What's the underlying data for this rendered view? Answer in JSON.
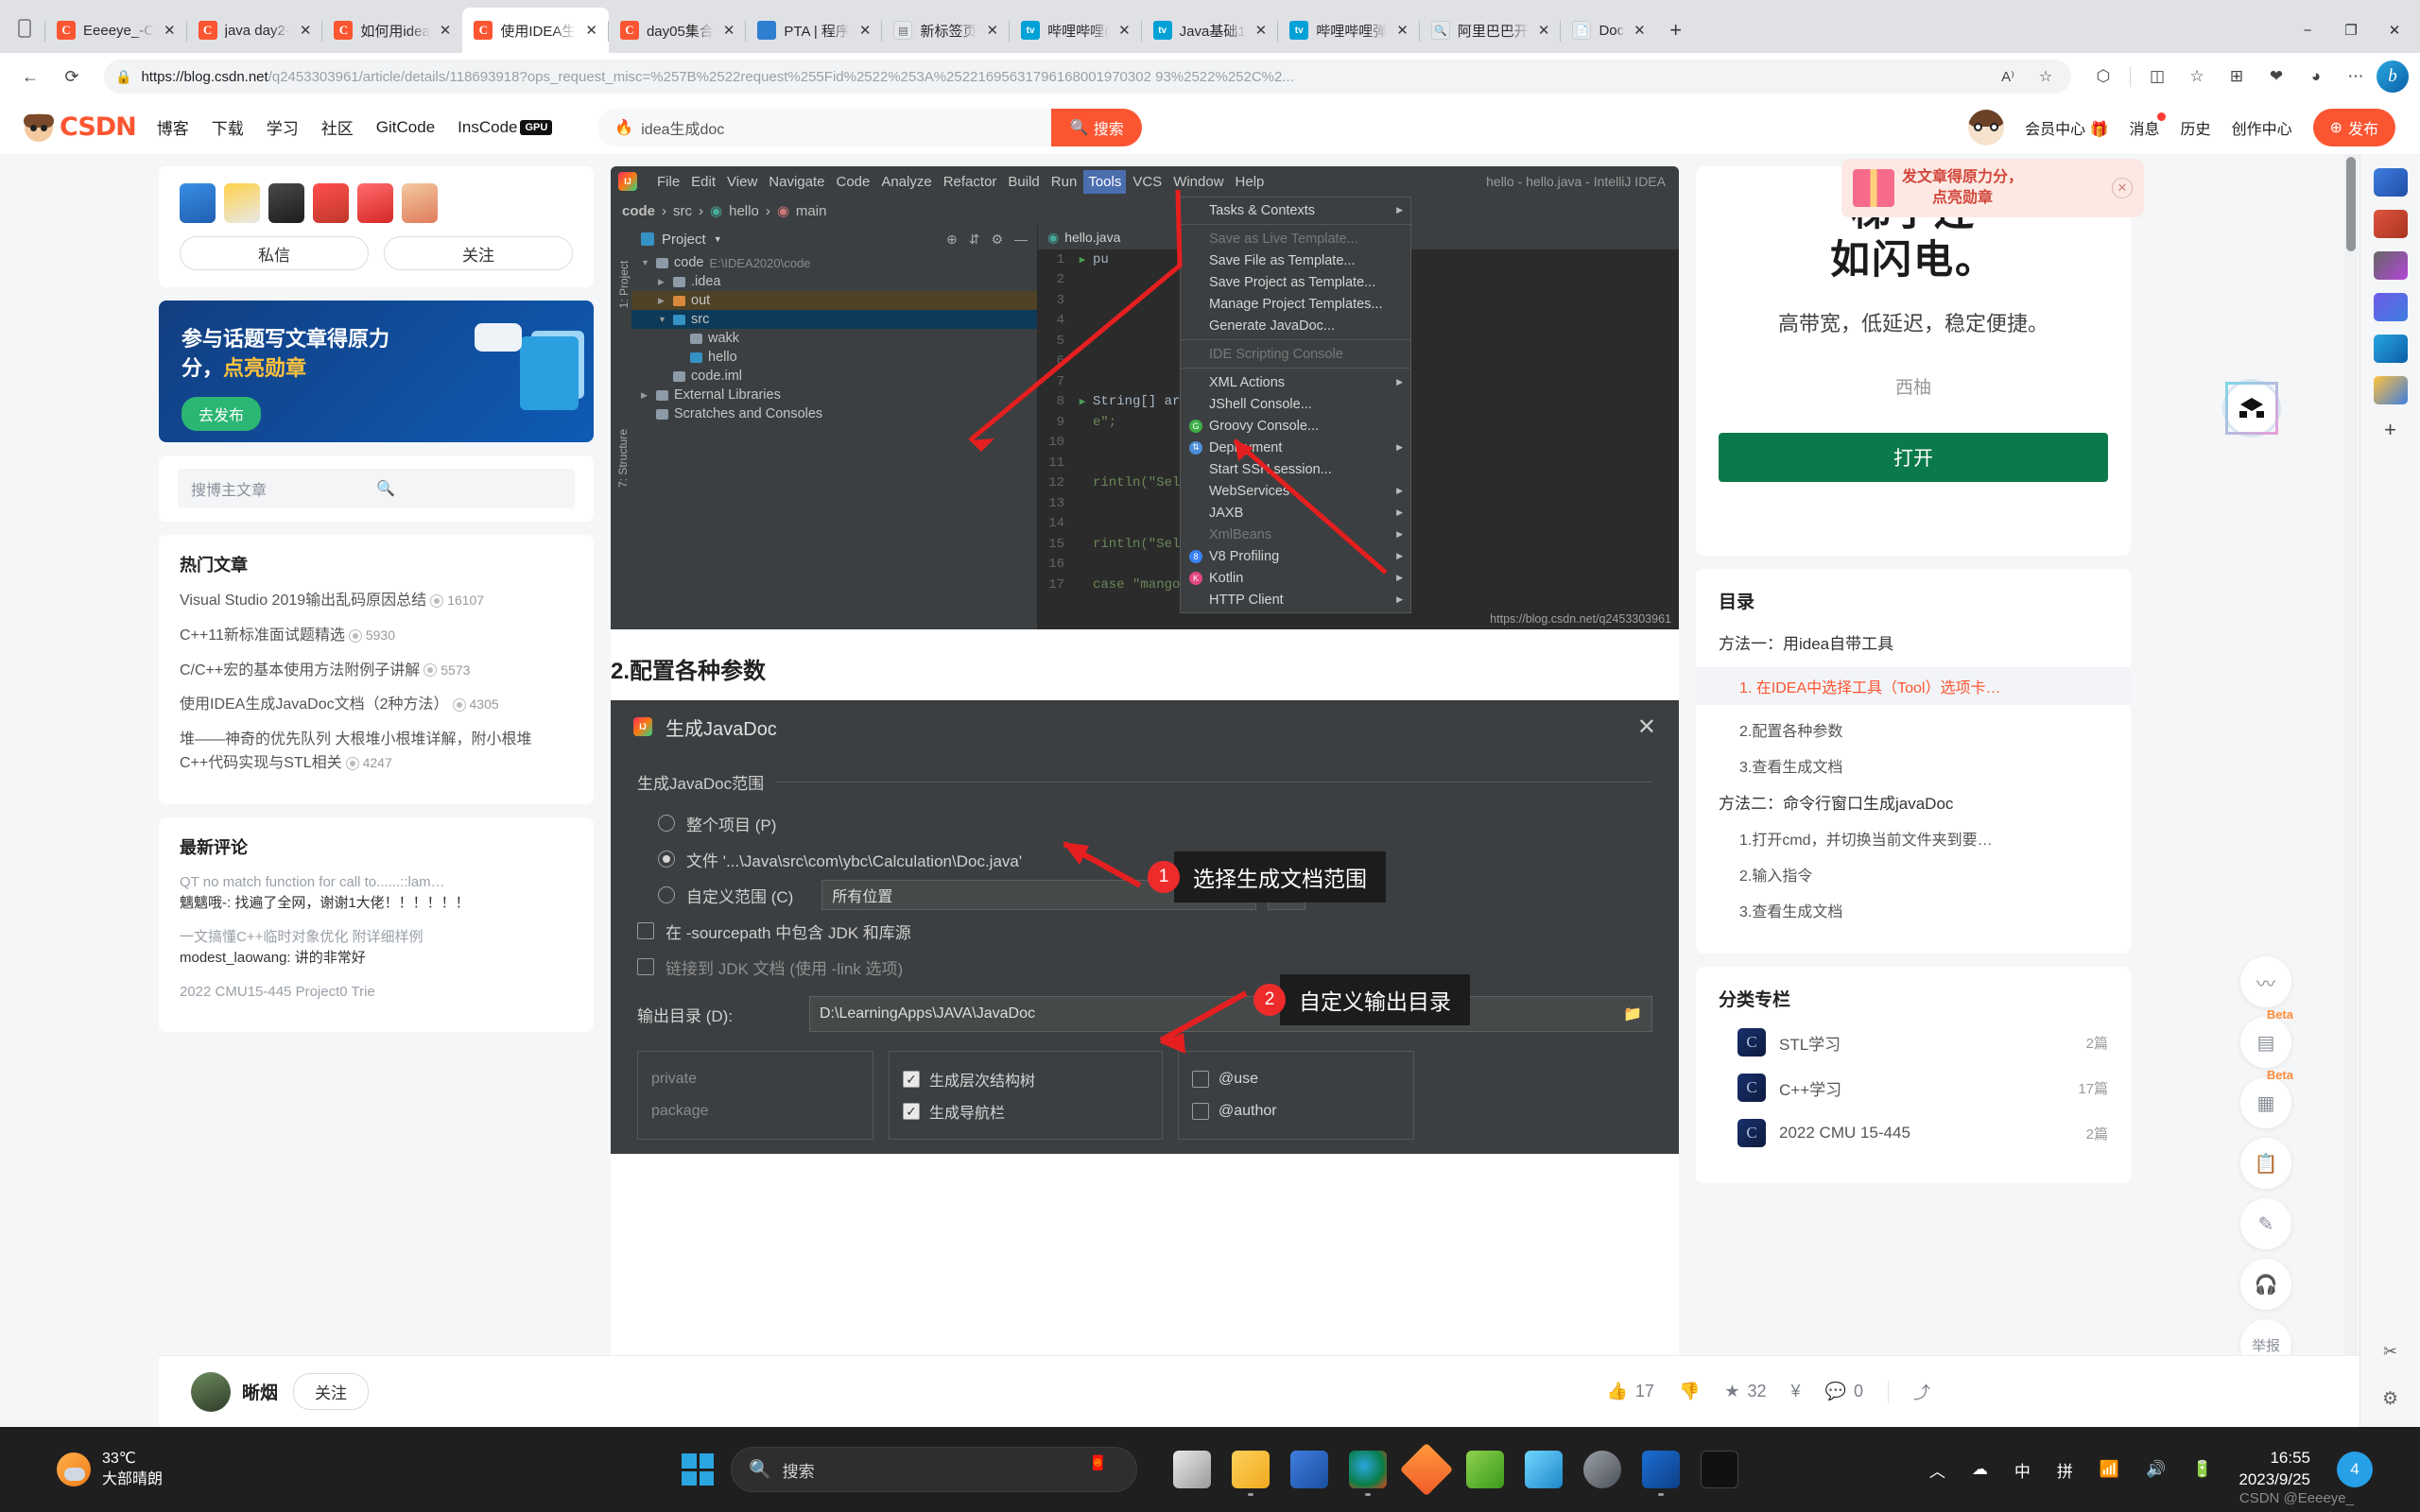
{
  "browser": {
    "tabs": [
      {
        "title": "Eeeeye_-C",
        "icon": "csdn-icon",
        "active": false
      },
      {
        "title": "java day2-",
        "icon": "csdn-icon",
        "active": false
      },
      {
        "title": "如何用idea",
        "icon": "csdn-icon",
        "active": false
      },
      {
        "title": "使用IDEA生",
        "icon": "csdn-icon",
        "active": true
      },
      {
        "title": "day05集合",
        "icon": "csdn-icon",
        "active": false
      },
      {
        "title": "PTA | 程序",
        "icon": "pta-icon",
        "active": false
      },
      {
        "title": "新标签页",
        "icon": "newtab-icon",
        "active": false
      },
      {
        "title": "哔哩哔哩(",
        "icon": "bilibili-icon",
        "active": false
      },
      {
        "title": "Java基础1",
        "icon": "bilibili-icon",
        "active": false
      },
      {
        "title": "哔哩哔哩弹",
        "icon": "bilibili-icon",
        "active": false
      },
      {
        "title": "阿里巴巴开",
        "icon": "search-icon",
        "active": false
      },
      {
        "title": "Doc",
        "icon": "file-icon",
        "active": false
      }
    ],
    "new_tab_label": "+",
    "window_controls": [
      "−",
      "❐",
      "✕"
    ],
    "url_bold": "https://blog.csdn.net",
    "url_rest": "/q2453303961/article/details/118693918?ops_request_misc=%257B%2522request%255Fid%2522%253A%25221695631796168001970302 93%2522%252C%2...",
    "back_icon": "back-arrow-icon",
    "reload_icon": "reload-icon",
    "lock_icon": "lock-icon",
    "read_aloud_icon": "read-aloud-icon",
    "favorite_icon": "star-icon",
    "toolbar_icons": [
      "puzzle-icon",
      "split-screen-icon",
      "favorites-icon",
      "collections-icon",
      "browser-essentials-icon",
      "profile-icon",
      "more-icon",
      "copilot-icon"
    ]
  },
  "site_header": {
    "logo_text": "CSDN",
    "nav": [
      "博客",
      "下载",
      "学习",
      "社区",
      "GitCode",
      "InsCode"
    ],
    "gpu_badge": "GPU",
    "search_value": "idea生成doc",
    "search_button": "搜索",
    "right_links": [
      "会员中心",
      "消息",
      "历史",
      "创作中心"
    ],
    "publish_button": "发布"
  },
  "left_sidebar": {
    "message_button": "私信",
    "follow_button": "关注",
    "promo": {
      "line1": "参与话题写文章得原力",
      "line2_plain": "分，",
      "line2_hl": "点亮勋章",
      "cta": "去发布"
    },
    "search_placeholder": "搜博主文章",
    "hot_title": "热门文章",
    "hot_articles": [
      {
        "title": "Visual Studio 2019输出乱码原因总结",
        "views": "16107"
      },
      {
        "title": "C++11新标准面试题精选",
        "views": "5930"
      },
      {
        "title": "C/C++宏的基本使用方法附例子讲解",
        "views": "5573"
      },
      {
        "title": "使用IDEA生成JavaDoc文档（2种方法）",
        "views": "4305"
      },
      {
        "title": "堆——神奇的优先队列 大根堆小根堆详解，附小根堆C++代码实现与STL相关",
        "views": "4247"
      }
    ],
    "comments_title": "最新评论",
    "comments": [
      {
        "article": "QT no match function for call to......::lam…",
        "body": "魑魑哦-: 找遍了全网，谢谢1大佬！！！！！！"
      },
      {
        "article": "一文搞懂C++临时对象优化 附详细样例",
        "body": "modest_laowang: 讲的非常好"
      },
      {
        "article": "2022 CMU15-445 Project0 Trie",
        "body": ""
      }
    ]
  },
  "ide_screenshot": {
    "window_title": "hello - hello.java - IntelliJ IDEA",
    "menubar": [
      "File",
      "Edit",
      "View",
      "Navigate",
      "Code",
      "Analyze",
      "Refactor",
      "Build",
      "Run",
      "Tools",
      "VCS",
      "Window",
      "Help"
    ],
    "active_menu": "Tools",
    "breadcrumb": [
      "code",
      "src",
      "hello",
      "main"
    ],
    "project_panel_title": "Project",
    "rail_top": "1: Project",
    "rail_bottom": "7: Structure",
    "tree": [
      {
        "label": "code",
        "path": "E:\\IDEA2020\\code",
        "depth": 0,
        "state": "open"
      },
      {
        "label": ".idea",
        "path": "",
        "depth": 1,
        "state": "closed"
      },
      {
        "label": "out",
        "path": "",
        "depth": 1,
        "state": "closed"
      },
      {
        "label": "src",
        "path": "",
        "depth": 1,
        "state": "open"
      },
      {
        "label": "wakk",
        "path": "",
        "depth": 2,
        "state": "leaf"
      },
      {
        "label": "hello",
        "path": "",
        "depth": 2,
        "state": "leaf"
      },
      {
        "label": "code.iml",
        "path": "",
        "depth": 1,
        "state": "leaf"
      },
      {
        "label": "External Libraries",
        "path": "",
        "depth": 0,
        "state": "closed"
      },
      {
        "label": "Scratches and Consoles",
        "path": "",
        "depth": 0,
        "state": "leaf"
      }
    ],
    "editor_tab": "hello.java",
    "editor_lines": [
      "1",
      "2",
      "3",
      "4",
      "5",
      "6",
      "7",
      "8",
      "9",
      "10",
      "11",
      "12",
      "13",
      "14",
      "15",
      "16",
      "17"
    ],
    "code_snippets": [
      {
        "line": 1,
        "text": "pu"
      },
      {
        "line": 8,
        "text": "String[] args) {"
      },
      {
        "line": 9,
        "text": "e\";"
      },
      {
        "line": 12,
        "text": "rintln(\"Selected apple\")"
      },
      {
        "line": 15,
        "text": "rintln(\"Selected pear\");"
      },
      {
        "line": 17,
        "text": "case \"mango\":"
      }
    ],
    "tools_menu": [
      {
        "label": "Tasks & Contexts",
        "submenu": true,
        "disabled": false,
        "icon": ""
      },
      {
        "label": "Save as Live Template...",
        "submenu": false,
        "disabled": true,
        "icon": ""
      },
      {
        "label": "Save File as Template...",
        "submenu": false,
        "disabled": false,
        "icon": ""
      },
      {
        "label": "Save Project as Template...",
        "submenu": false,
        "disabled": false,
        "icon": ""
      },
      {
        "label": "Manage Project Templates...",
        "submenu": false,
        "disabled": false,
        "icon": ""
      },
      {
        "label": "Generate JavaDoc...",
        "submenu": false,
        "disabled": false,
        "icon": ""
      },
      {
        "label": "IDE Scripting Console",
        "submenu": false,
        "disabled": true,
        "icon": ""
      },
      {
        "label": "XML Actions",
        "submenu": true,
        "disabled": false,
        "icon": ""
      },
      {
        "label": "JShell Console...",
        "submenu": false,
        "disabled": false,
        "icon": ""
      },
      {
        "label": "Groovy Console...",
        "submenu": false,
        "disabled": false,
        "icon": "groovy-icon"
      },
      {
        "label": "Deployment",
        "submenu": true,
        "disabled": false,
        "icon": "deployment-icon"
      },
      {
        "label": "Start SSH session...",
        "submenu": false,
        "disabled": false,
        "icon": ""
      },
      {
        "label": "WebServices",
        "submenu": true,
        "disabled": false,
        "icon": ""
      },
      {
        "label": "JAXB",
        "submenu": true,
        "disabled": false,
        "icon": ""
      },
      {
        "label": "XmlBeans",
        "submenu": true,
        "disabled": true,
        "icon": ""
      },
      {
        "label": "V8 Profiling",
        "submenu": true,
        "disabled": false,
        "icon": "v8-icon"
      },
      {
        "label": "Kotlin",
        "submenu": true,
        "disabled": false,
        "icon": "kotlin-icon"
      },
      {
        "label": "HTTP Client",
        "submenu": true,
        "disabled": false,
        "icon": ""
      }
    ],
    "watermark": "https://blog.csdn.net/q2453303961"
  },
  "article": {
    "section2_heading": "2.配置各种参数",
    "javadoc_dialog": {
      "title": "生成JavaDoc",
      "close_label": "✕",
      "scope_legend": "生成JavaDoc范围",
      "radio_project": "整个项目 (P)",
      "radio_file": "文件 '...\\Java\\src\\com\\ybc\\Calculation\\Doc.java'",
      "radio_custom": "自定义范围 (C)",
      "custom_scope_value": "所有位置",
      "browse_button": "...",
      "check_sourcepath": "在 -sourcepath 中包含 JDK 和库源",
      "check_link_jdk": "链接到 JDK 文档 (使用 -link 选项)",
      "output_label": "输出目录 (D):",
      "output_value": "D:\\LearningApps\\JAVA\\JavaDoc",
      "visibility": [
        "private",
        "package"
      ],
      "right_checks": [
        {
          "label": "生成层次结构树",
          "checked": true
        },
        {
          "label": "生成导航栏",
          "checked": true
        }
      ],
      "tag_checks": [
        {
          "label": "@use",
          "checked": false
        },
        {
          "label": "@author",
          "checked": false
        }
      ],
      "callout1_num": "1",
      "callout1_text": "选择生成文档范围",
      "callout2_num": "2",
      "callout2_text": "自定义输出目录"
    }
  },
  "right_sidebar": {
    "ad": {
      "title_line1": "梯子连",
      "title_line2": "如闪电。",
      "desc": "高带宽，低延迟，稳定便捷。",
      "brand": "西柚",
      "button": "打开"
    },
    "toast": {
      "line1": "发文章得原力分，",
      "line2": "点亮勋章",
      "close": "✕"
    },
    "toc_title": "目录",
    "toc": [
      {
        "level": 1,
        "label": "方法一：用idea自带工具",
        "active": false
      },
      {
        "level": 2,
        "label": "1. 在IDEA中选择工具（Tool）选项卡…",
        "active": true
      },
      {
        "level": 2,
        "label": "2.配置各种参数",
        "active": false
      },
      {
        "level": 2,
        "label": "3.查看生成文档",
        "active": false
      },
      {
        "level": 1,
        "label": "方法二：命令行窗口生成javaDoc",
        "active": false
      },
      {
        "level": 2,
        "label": "1.打开cmd，并切换当前文件夹到要…",
        "active": false
      },
      {
        "level": 2,
        "label": "2.输入指令",
        "active": false
      },
      {
        "level": 2,
        "label": "3.查看生成文档",
        "active": false
      }
    ],
    "category_title": "分类专栏",
    "categories": [
      {
        "name": "STL学习",
        "count": "2篇"
      },
      {
        "name": "C++学习",
        "count": "17篇"
      },
      {
        "name": "2022 CMU 15-445",
        "count": "2篇"
      }
    ],
    "side_buttons": [
      {
        "icon": "chart-icon",
        "beta": ""
      },
      {
        "icon": "list-icon",
        "beta": "Beta"
      },
      {
        "icon": "layout-icon",
        "beta": "Beta"
      },
      {
        "icon": "clipboard-icon",
        "beta": ""
      },
      {
        "icon": "edit-icon",
        "beta": ""
      },
      {
        "icon": "headset-icon",
        "beta": ""
      },
      {
        "icon": "report-icon",
        "beta": "",
        "label": "举报"
      }
    ]
  },
  "action_bar": {
    "author": "晰烟",
    "follow": "关注",
    "likes": "17",
    "dislikes": "",
    "favorites": "32",
    "reward_icon": "reward-icon",
    "comments": "0",
    "share_icon": "share-icon"
  },
  "taskbar": {
    "temperature": "33℃",
    "weather": "大部晴朗",
    "search_placeholder": "搜索",
    "time": "16:55",
    "date": "2023/9/25",
    "notification_count": "4",
    "tray_icons": [
      "chevron-up-icon",
      "cloud-off-icon",
      "ime-chinese-icon",
      "pinyin-icon",
      "wifi-icon",
      "volume-icon",
      "battery-icon"
    ],
    "ime_chinese": "中",
    "ime_pinyin": "拼",
    "watermark": "CSDN @Eeeeye_"
  }
}
